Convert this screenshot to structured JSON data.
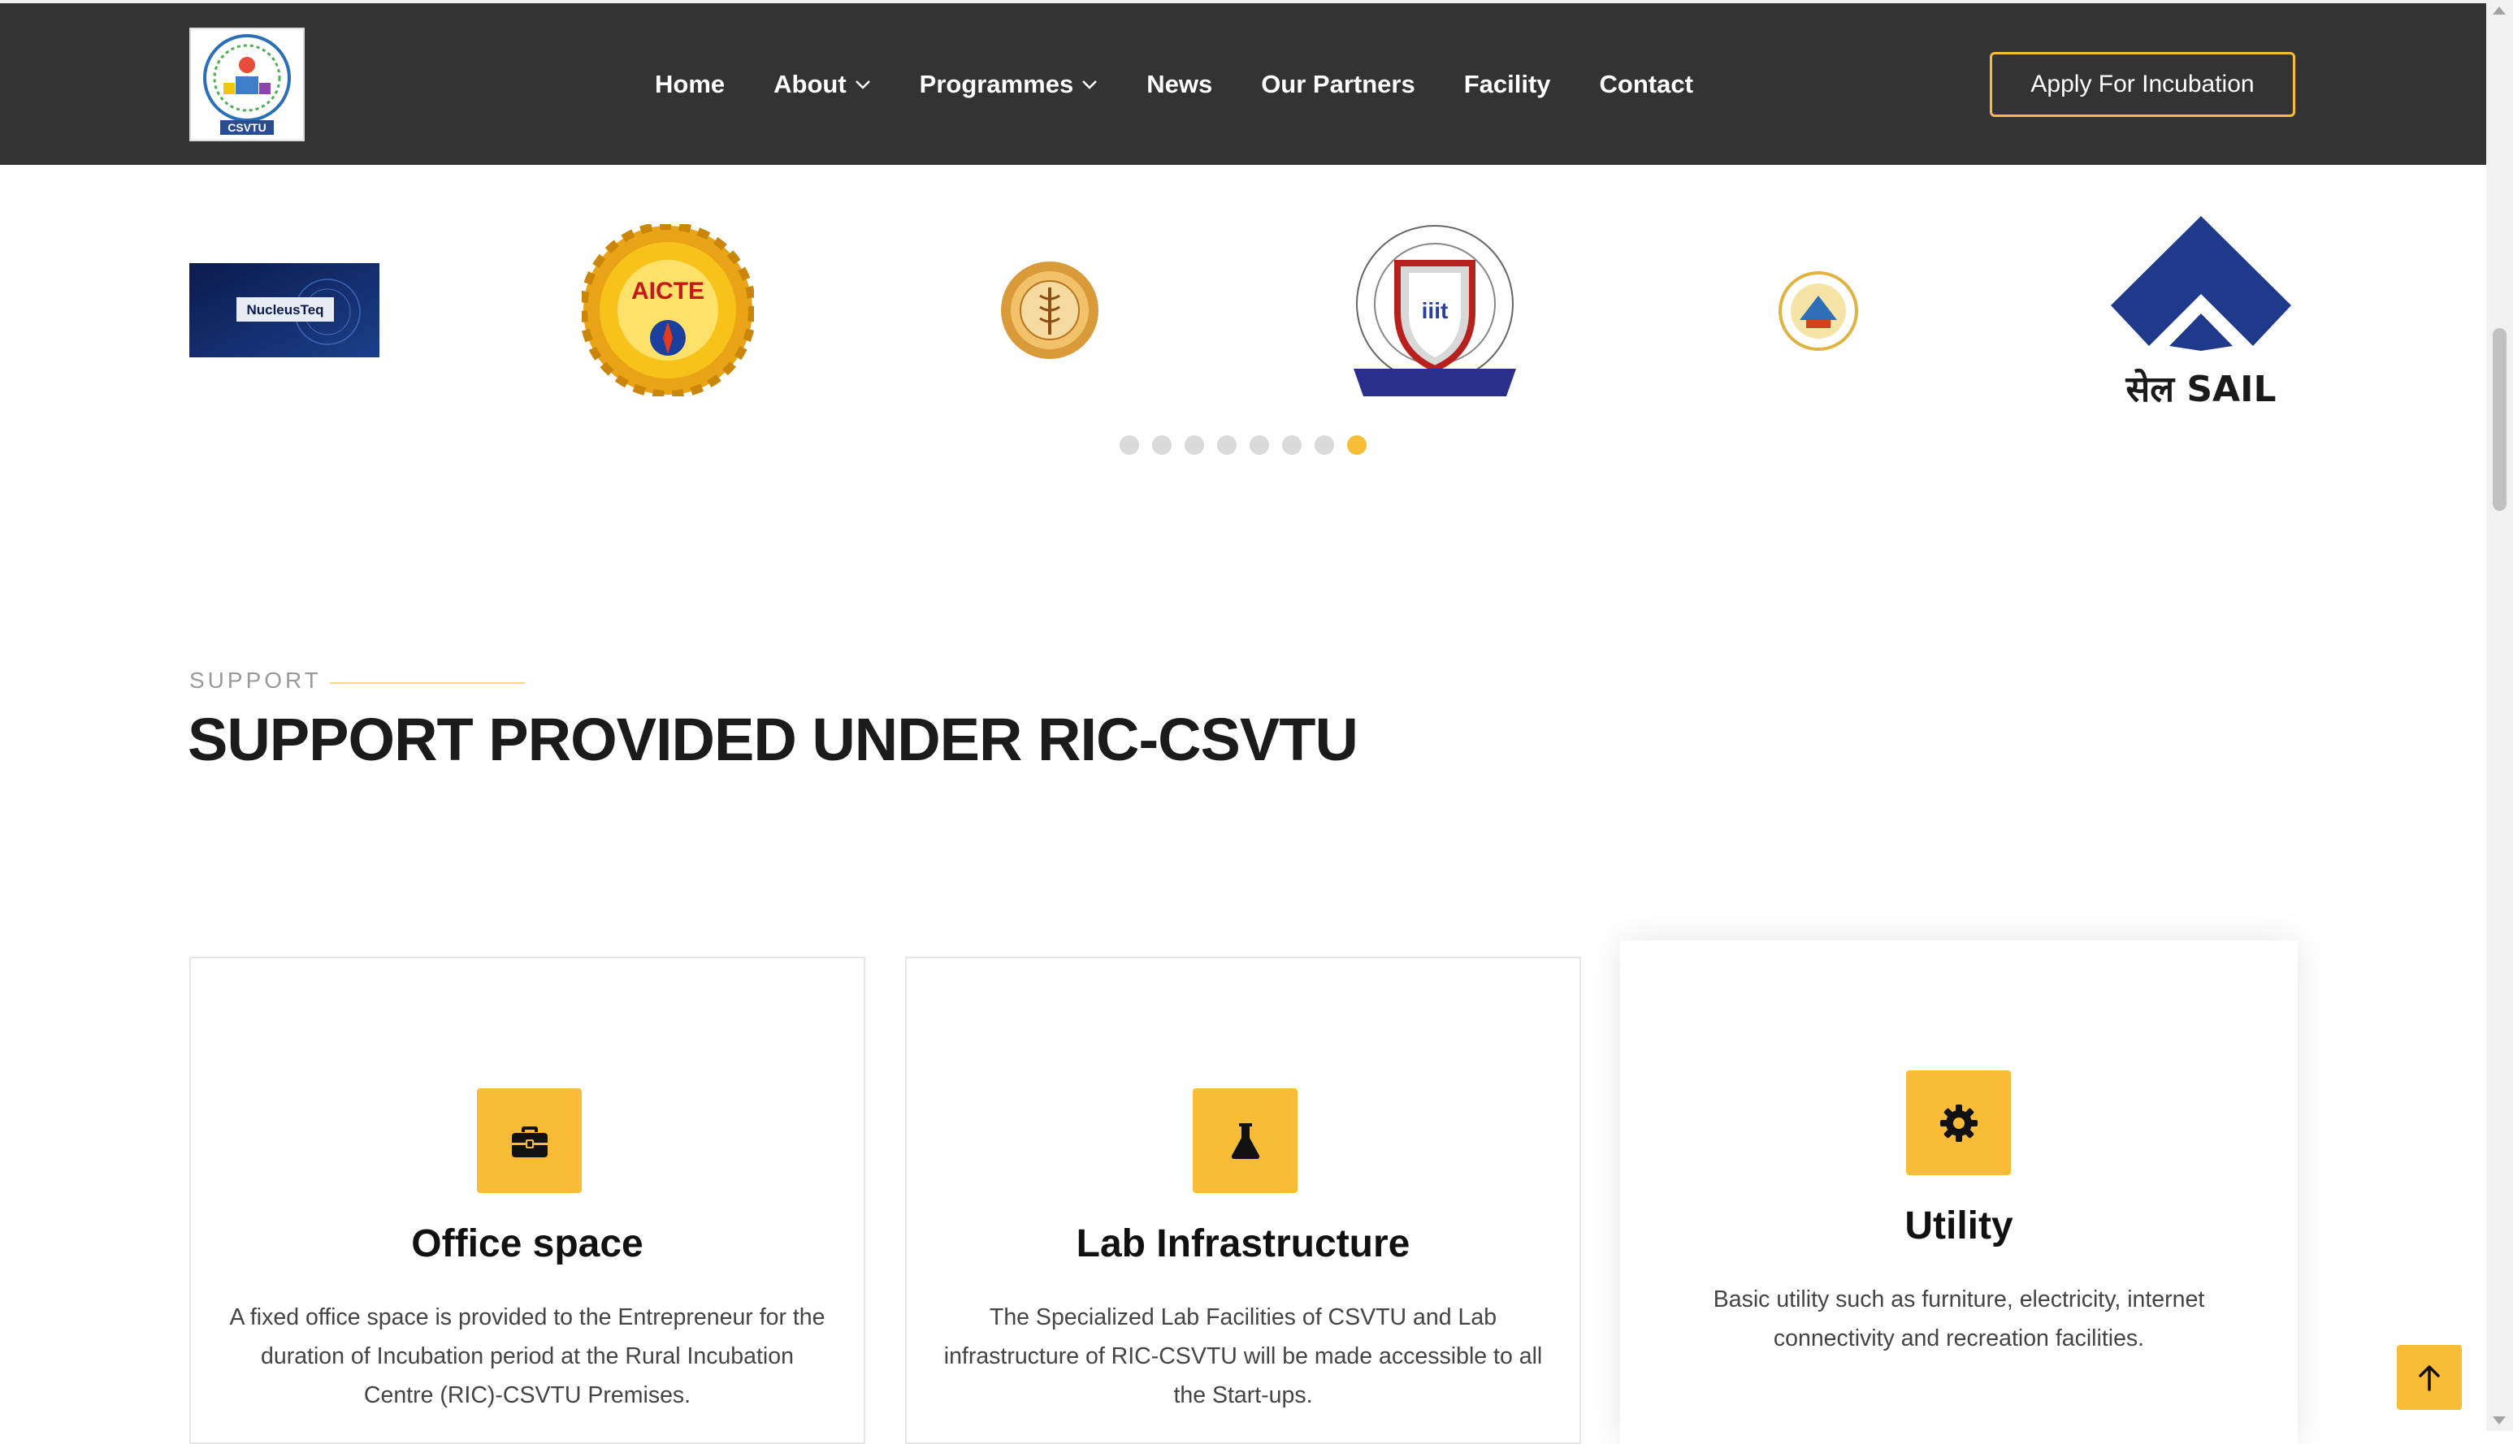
{
  "header": {
    "logo_alt": "CSVTU",
    "nav": [
      {
        "label": "Home",
        "has_dropdown": false
      },
      {
        "label": "About",
        "has_dropdown": true
      },
      {
        "label": "Programmes",
        "has_dropdown": true
      },
      {
        "label": "News",
        "has_dropdown": false
      },
      {
        "label": "Our Partners",
        "has_dropdown": false
      },
      {
        "label": "Facility",
        "has_dropdown": false
      },
      {
        "label": "Contact",
        "has_dropdown": false
      }
    ],
    "apply_button": "Apply For Incubation"
  },
  "partners": {
    "logos": [
      {
        "name": "NucleusTeq",
        "text": "NucleusTeq"
      },
      {
        "name": "AICTE",
        "text": "AICTE"
      },
      {
        "name": "Medical university seal",
        "text": ""
      },
      {
        "name": "IIIT Pune",
        "text": "iiit"
      },
      {
        "name": "Regional institute seal",
        "text": ""
      },
      {
        "name": "SAIL",
        "text": "सेल SAIL"
      }
    ],
    "dots_total": 8,
    "active_dot": 8
  },
  "section": {
    "eyebrow": "SUPPORT",
    "title": "SUPPORT PROVIDED UNDER RIC-CSVTU"
  },
  "cards": [
    {
      "icon": "briefcase-icon",
      "title": "Office space",
      "text": "A fixed office space is provided to the Entrepreneur for the duration of Incubation period at the Rural Incubation Centre (RIC)-CSVTU Premises."
    },
    {
      "icon": "flask-icon",
      "title": "Lab Infrastructure",
      "text": "The Specialized Lab Facilities of CSVTU and Lab infrastructure of RIC-CSVTU will be made accessible to all the Start-ups."
    },
    {
      "icon": "gear-icon",
      "title": "Utility",
      "text": "Basic utility such as furniture, electricity, internet connectivity and recreation facilities."
    }
  ],
  "colors": {
    "header_bg": "#333333",
    "accent": "#f9bc36",
    "sail_blue": "#1f3a8a"
  }
}
